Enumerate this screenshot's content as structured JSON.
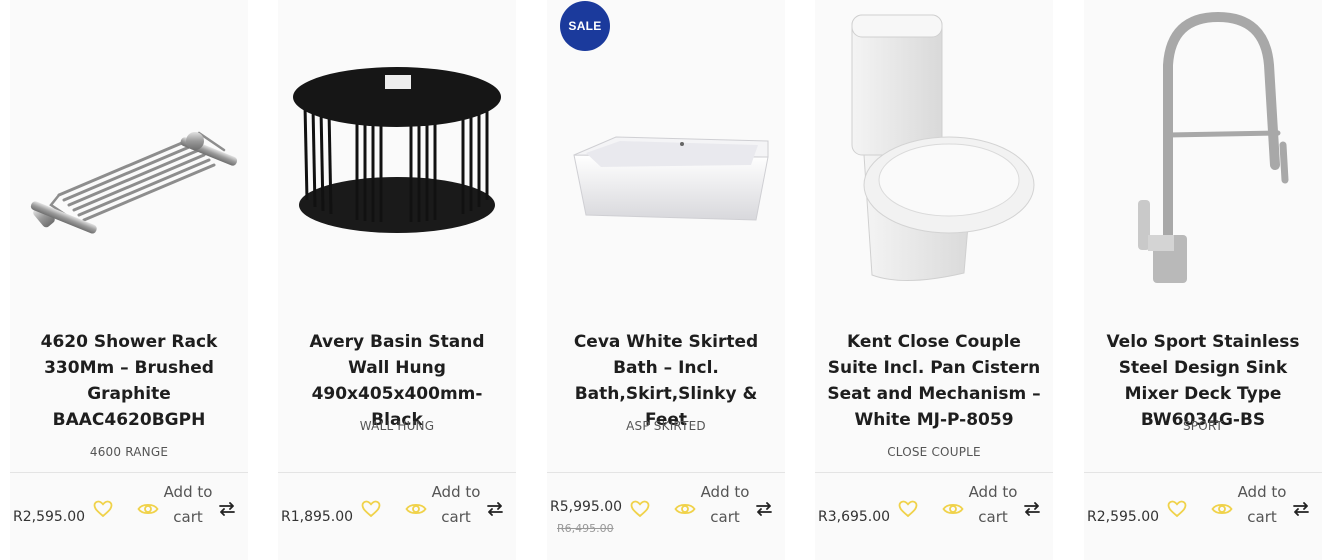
{
  "accent_color": "#f0d24a",
  "sale_badge_color": "#1b3a9c",
  "products": [
    {
      "name": "4620 Shower Rack 330Mm – Brushed Graphite BAAC4620BGPH",
      "category": "4600 RANGE",
      "price": "R2,595.00",
      "wishlist_icon": "heart-icon",
      "quickview_icon": "eye-icon",
      "add_to_cart": "Add to cart",
      "compare_icon": "compare-arrows-icon"
    },
    {
      "name": "Avery Basin Stand Wall Hung 490x405x400mm- Black",
      "category": "WALL HUNG",
      "price": "R1,895.00",
      "add_to_cart": "Add to cart"
    },
    {
      "name": "Ceva White Skirted Bath – Incl. Bath,Skirt,Slinky & Feet",
      "category": "ASP SKIRTED",
      "price": "R5,995.00",
      "old_price": "R6,495.00",
      "badge": "SALE",
      "add_to_cart": "Add to cart"
    },
    {
      "name": "Kent Close Couple Suite Incl. Pan Cistern Seat and Mechanism – White MJ-P-8059",
      "category": "CLOSE COUPLE",
      "price": "R3,695.00",
      "add_to_cart": "Add to cart"
    },
    {
      "name": "Velo Sport Stainless Steel Design Sink Mixer Deck Type BW6034G-BS",
      "category": "SPORT",
      "price": "R2,595.00",
      "add_to_cart": "Add to cart"
    }
  ]
}
